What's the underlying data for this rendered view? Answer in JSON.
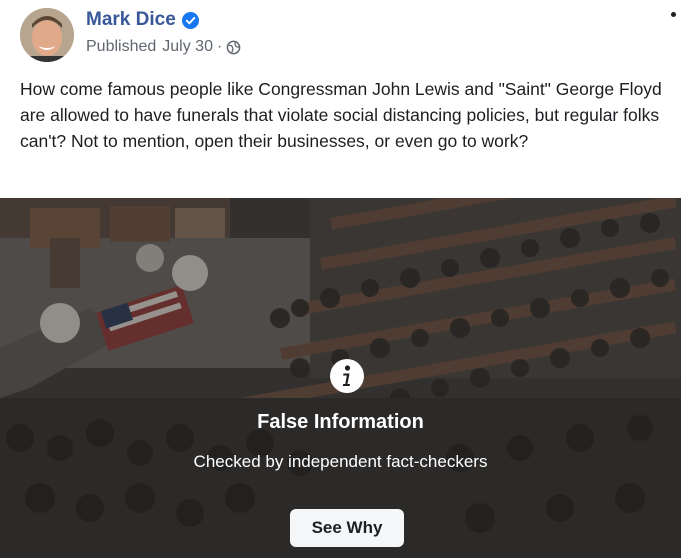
{
  "post": {
    "author": "Mark Dice",
    "published_label": "Published",
    "date": "July 30",
    "separator": "·",
    "verified_icon": "verified-badge-icon",
    "privacy_icon": "globe-icon",
    "text": "How come famous people like Congressman John Lewis and \"Saint\" George Floyd are allowed to have funerals that violate social distancing policies, but regular folks can't? Not to mention, open their businesses, or even go to work?"
  },
  "fact_check": {
    "icon": "info-icon",
    "title": "False Information",
    "subtitle": "Checked by independent fact-checkers",
    "button_label": "See Why"
  },
  "colors": {
    "author_link": "#385898",
    "verified": "#1877f2",
    "meta_text": "#606770",
    "body_text": "#1c1e21"
  }
}
